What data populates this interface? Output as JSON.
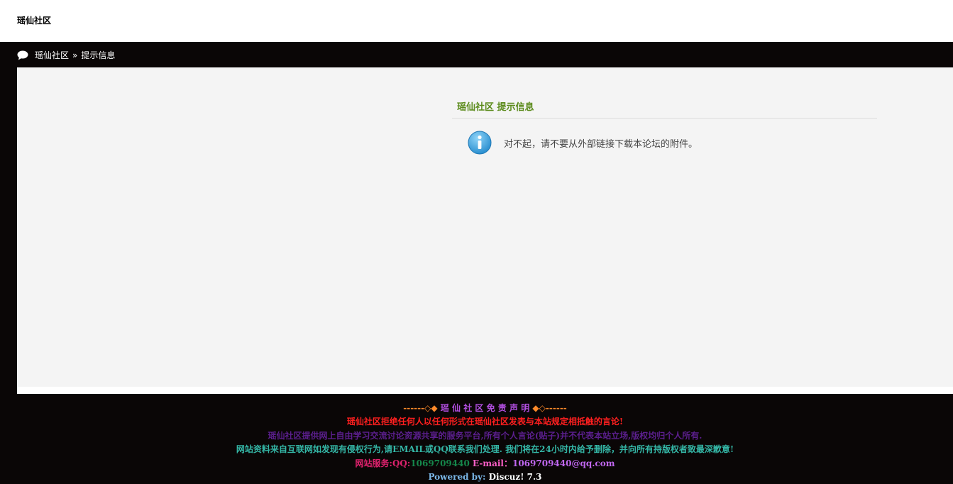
{
  "header": {
    "site_title": "瑶仙社区"
  },
  "breadcrumb": {
    "home": "瑶仙社区",
    "separator": "»",
    "current": "提示信息"
  },
  "message": {
    "title": "瑶仙社区 提示信息",
    "text": "对不起，请不要从外部链接下载本论坛的附件。",
    "icon": "info-icon"
  },
  "footer": {
    "disclaimer_title": "------◇◆ 瑶 仙 社 区 免 责 声 明 ◆◇------",
    "line1": "瑶仙社区拒绝任何人以任何形式在瑶仙社区发表与本站规定相抵触的言论!",
    "line2": "瑶仙社区提供网上自由学习交流讨论资源共享的服务平台,所有个人言论(贴子)并不代表本站立场,版权均归个人所有.",
    "line3": "网站资料来自互联网如发现有侵权行为,请EMAIL或QQ联系我们处理. 我们将在24小时内给予删除，并向所有持版权者致最深歉意!",
    "service_label": "网站服务:QQ:",
    "service_qq": "1069709440",
    "email_label": "E-mail：",
    "email": "1069709440@qq.com",
    "powered_label": "Powered by:",
    "powered_value": "Discuz! 7.3"
  },
  "colors": {
    "page_bg": "#0a0606",
    "content_bg": "#f4f4f4",
    "title_green": "#5a8a1a",
    "info_blue": "#3aa0dc"
  }
}
